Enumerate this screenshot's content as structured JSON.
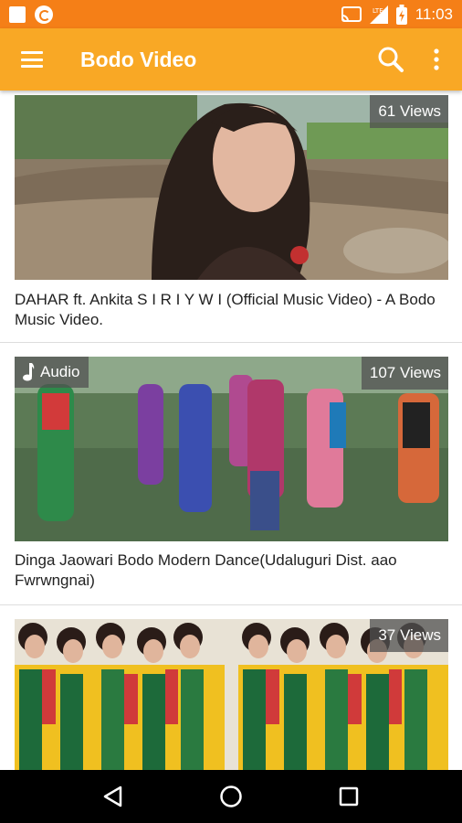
{
  "status_bar": {
    "time": "11:03",
    "icons": [
      "square-notification-icon",
      "sync-notification-icon",
      "cast-icon",
      "signal-icon",
      "battery-icon"
    ]
  },
  "app_bar": {
    "title": "Bodo Video",
    "menu_icon": "hamburger-menu-icon",
    "search_icon": "search-icon",
    "more_icon": "more-vert-icon"
  },
  "videos": [
    {
      "views": "61 Views",
      "title": "DAHAR ft.  Ankita   S I R I Y W I  (Official Music Video) - A Bodo Music Video.",
      "audio": ""
    },
    {
      "views": "107 Views",
      "title": "Dinga Jaowari Bodo Modern Dance(Udaluguri Dist. aao Fwrwngnai)",
      "audio": "Audio"
    },
    {
      "views": "37 Views",
      "title": "",
      "audio": ""
    }
  ],
  "nav_bar": {
    "back_icon": "back-triangle-icon",
    "home_icon": "home-circle-icon",
    "recents_icon": "recents-square-icon"
  },
  "colors": {
    "status_bar": "#f57f17",
    "app_bar": "#f9a825",
    "nav_bar": "#000000"
  }
}
